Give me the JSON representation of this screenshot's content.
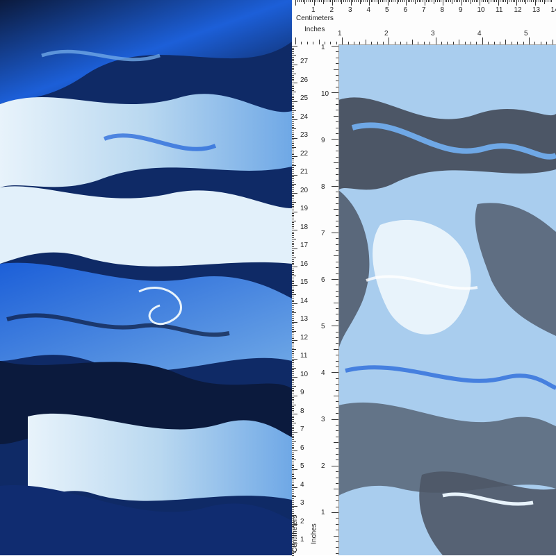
{
  "image": {
    "subject": "blue marble-swirl printed mesh fabric",
    "colors": {
      "royal_blue": "#1c5fd8",
      "navy": "#0b1a3d",
      "pale_blue": "#b9d8f0",
      "sky_blue": "#6fa8e6",
      "charcoal": "#4c5666",
      "white_mist": "#e8f3fb"
    }
  },
  "ruler": {
    "top_cm_label": "Centimeters",
    "top_in_label": "Inches",
    "side_cm_label": "Centimeters",
    "side_in_label": "Inches",
    "top_cm_numbers": [
      "1",
      "2",
      "3",
      "4",
      "5",
      "6",
      "7",
      "8",
      "9",
      "10",
      "11",
      "12",
      "13",
      "14"
    ],
    "top_in_numbers": [
      "1",
      "2",
      "3",
      "4",
      "5"
    ],
    "side_cm_numbers": [
      "27",
      "26",
      "25",
      "24",
      "23",
      "22",
      "21",
      "20",
      "19",
      "18",
      "17",
      "16",
      "15",
      "14",
      "13",
      "12",
      "11",
      "10",
      "9",
      "8",
      "7",
      "6",
      "5",
      "4",
      "3",
      "2",
      "1"
    ],
    "side_in_numbers": [
      "1",
      "10",
      "9",
      "8",
      "7",
      "6",
      "5",
      "4",
      "3",
      "2",
      "1"
    ]
  }
}
